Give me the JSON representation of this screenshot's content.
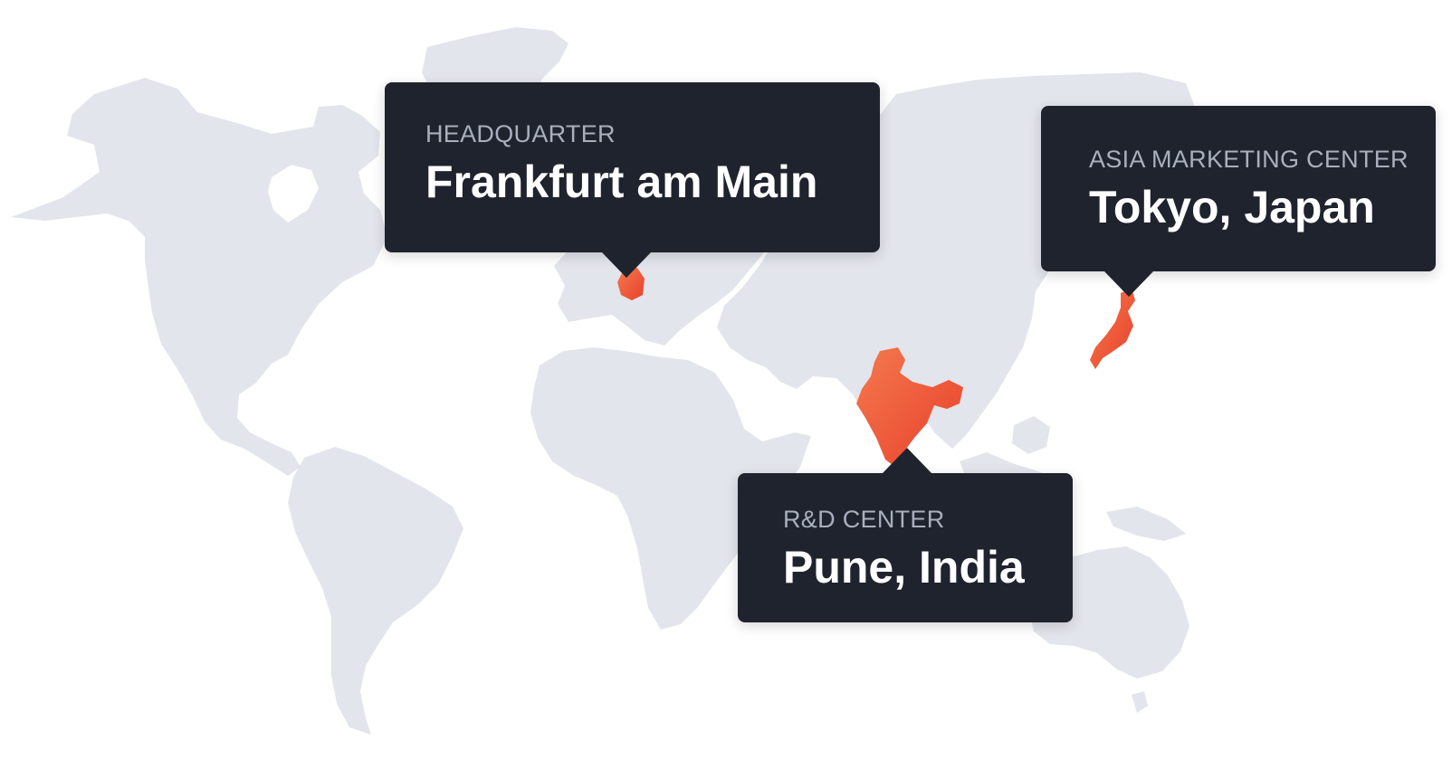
{
  "colors": {
    "land": "#e3e5ec",
    "highlight_start": "#f47a4f",
    "highlight_end": "#e8402a",
    "callout_bg": "#1f232d",
    "label_text": "#a9afbd",
    "city_text": "#ffffff"
  },
  "locations": {
    "headquarter": {
      "label": "HEADQUARTER",
      "city": "Frankfurt am Main"
    },
    "asia_marketing": {
      "label": "ASIA MARKETING CENTER",
      "city": "Tokyo, Japan"
    },
    "rnd": {
      "label": "R&D CENTER",
      "city": "Pune, India"
    }
  }
}
